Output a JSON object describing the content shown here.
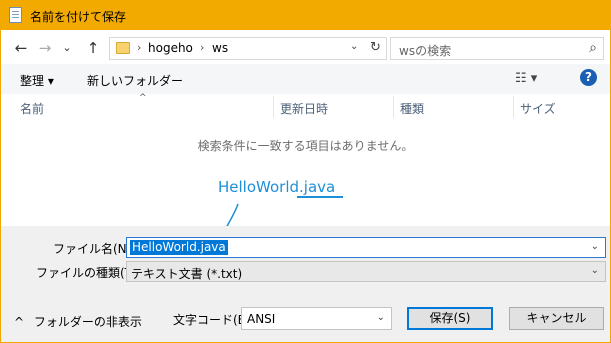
{
  "window": {
    "title": "名前を付けて保存"
  },
  "nav": {
    "back": "←",
    "forward": "→",
    "dropdown": "⌄",
    "up": "↑"
  },
  "address": {
    "crumbs": [
      "hogeho",
      "ws"
    ],
    "separator": "›",
    "refresh": "↻",
    "dropdown": "⌄"
  },
  "search": {
    "placeholder": "wsの検索",
    "icon": "search-icon"
  },
  "toolbar": {
    "organize": "整理 ▾",
    "new_folder": "新しいフォルダー",
    "views": "☷ ▾",
    "help": "?"
  },
  "columns": {
    "sort_indicator": "^",
    "name": "名前",
    "date": "更新日時",
    "type": "種類",
    "size": "サイズ"
  },
  "empty_message": "検索条件に一致する項目はありません。",
  "annotation": {
    "text": "HelloWorld.java",
    "arrow_color": "#1e8fd6"
  },
  "form": {
    "filename_label": "ファイル名(N):",
    "filename_value": "HelloWorld.java",
    "filetype_label": "ファイルの種類(T):",
    "filetype_value": "テキスト文書 (*.txt)",
    "combo_arrow": "⌄"
  },
  "footer": {
    "hide_folders": "フォルダーの非表示",
    "hide_folders_icon": "^",
    "encoding_label": "文字コード(E):",
    "encoding_value": "ANSI",
    "save": "保存(S)",
    "cancel": "キャンセル"
  },
  "colors": {
    "title_bar": "#f2a900",
    "selection": "#0078d7",
    "annotation": "#1e8fd6"
  }
}
